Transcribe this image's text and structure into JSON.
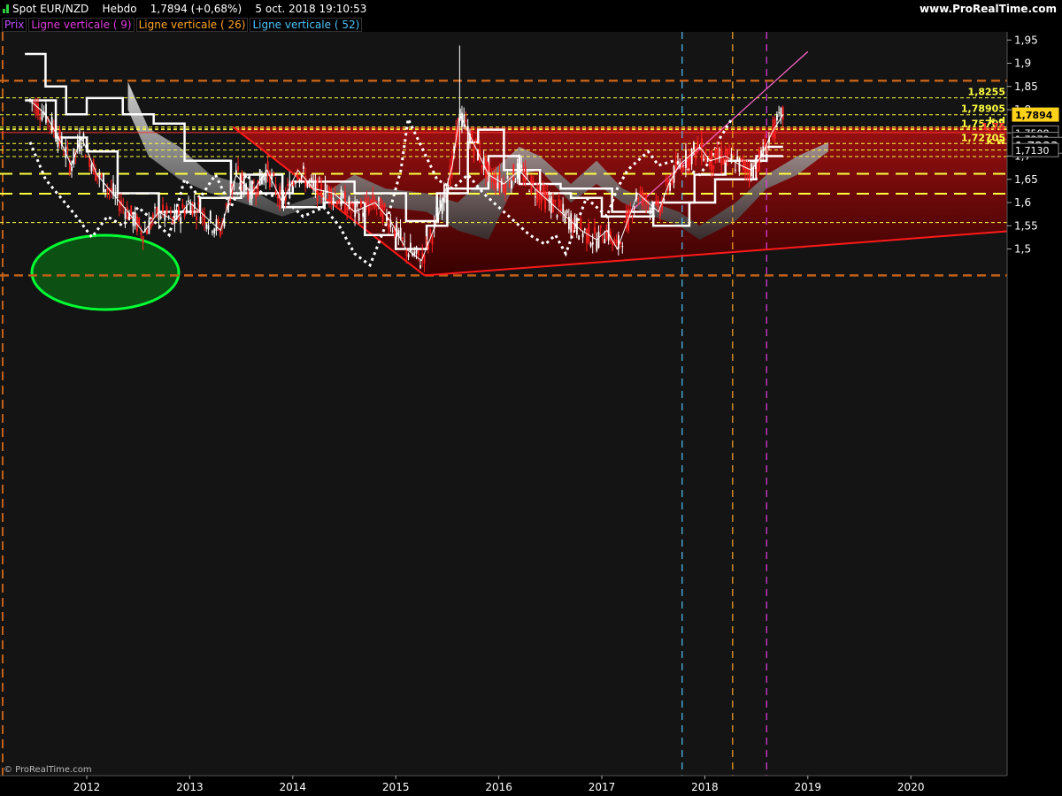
{
  "header": {
    "symbol": "Spot EUR/NZD",
    "period": "Hebdo",
    "price": "1,7894 (+0,68%)",
    "datetime": "5 oct. 2018 19:10:53",
    "site": "www.ProRealTime.com"
  },
  "legend": [
    {
      "label": "Prix",
      "color": "#c050ff"
    },
    {
      "label": "Ligne verticale ( 9)",
      "color": "#e040e0"
    },
    {
      "label": "Ligne verticale ( 26)",
      "color": "#ffa726"
    },
    {
      "label": "Ligne verticale ( 52)",
      "color": "#4fc3f7"
    }
  ],
  "watermark": "© ProRealTime.com",
  "colors": {
    "background": "#000000",
    "plot_background": "#141414",
    "triangle_fill": "#8b0000",
    "candle_up": "#ffffff",
    "candle_down": "#ff2020",
    "cloud_top": "#f0f0f0",
    "cloud_bottom": "#333333",
    "fib_line": "#ffff40",
    "resistance": "#c06018",
    "green_ellipse": "#00ff33",
    "trend_red": "#ff1a1a",
    "trend_pink": "#ff66cc"
  },
  "chart_data": {
    "type": "line",
    "instrument": "EUR/NZD",
    "timeframe": "weekly",
    "x_axis_ticks": [
      "2012",
      "2013",
      "2014",
      "2015",
      "2016",
      "2017",
      "2018",
      "2019",
      "2020"
    ],
    "y_axis_ticks": [
      "1,95",
      "1,9",
      "1,85",
      "1,8",
      "1,75",
      "1,7",
      "1,65",
      "1,6",
      "1,55",
      "1,5"
    ],
    "y_ticks_values": [
      1.95,
      1.9,
      1.85,
      1.8,
      1.75,
      1.7,
      1.65,
      1.6,
      1.55,
      1.5
    ],
    "ylim": [
      1.445,
      1.96
    ],
    "xlim": [
      2011.4,
      2021.2
    ],
    "grid": false,
    "price_path": [
      [
        2011.45,
        1.82
      ],
      [
        2011.6,
        1.79
      ],
      [
        2011.75,
        1.73
      ],
      [
        2011.85,
        1.68
      ],
      [
        2011.95,
        1.74
      ],
      [
        2012.1,
        1.66
      ],
      [
        2012.25,
        1.62
      ],
      [
        2012.4,
        1.58
      ],
      [
        2012.55,
        1.535
      ],
      [
        2012.7,
        1.58
      ],
      [
        2012.85,
        1.56
      ],
      [
        2013.0,
        1.6
      ],
      [
        2013.15,
        1.57
      ],
      [
        2013.3,
        1.54
      ],
      [
        2013.45,
        1.66
      ],
      [
        2013.6,
        1.62
      ],
      [
        2013.75,
        1.67
      ],
      [
        2013.9,
        1.6
      ],
      [
        2014.05,
        1.67
      ],
      [
        2014.2,
        1.63
      ],
      [
        2014.4,
        1.62
      ],
      [
        2014.6,
        1.58
      ],
      [
        2014.8,
        1.6
      ],
      [
        2014.95,
        1.56
      ],
      [
        2015.1,
        1.5
      ],
      [
        2015.25,
        1.475
      ],
      [
        2015.4,
        1.56
      ],
      [
        2015.55,
        1.68
      ],
      [
        2015.62,
        1.79
      ],
      [
        2015.75,
        1.73
      ],
      [
        2015.9,
        1.66
      ],
      [
        2016.05,
        1.64
      ],
      [
        2016.2,
        1.67
      ],
      [
        2016.35,
        1.63
      ],
      [
        2016.5,
        1.6
      ],
      [
        2016.65,
        1.57
      ],
      [
        2016.8,
        1.54
      ],
      [
        2016.95,
        1.52
      ],
      [
        2017.05,
        1.54
      ],
      [
        2017.15,
        1.5
      ],
      [
        2017.25,
        1.56
      ],
      [
        2017.35,
        1.62
      ],
      [
        2017.45,
        1.6
      ],
      [
        2017.55,
        1.58
      ],
      [
        2017.65,
        1.64
      ],
      [
        2017.75,
        1.68
      ],
      [
        2017.85,
        1.7
      ],
      [
        2017.95,
        1.72
      ],
      [
        2018.05,
        1.69
      ],
      [
        2018.2,
        1.7
      ],
      [
        2018.35,
        1.68
      ],
      [
        2018.45,
        1.67
      ],
      [
        2018.55,
        1.7
      ],
      [
        2018.65,
        1.75
      ],
      [
        2018.76,
        1.7894
      ]
    ],
    "annotations": [
      {
        "label": "1,8255",
        "value": 1.8255
      },
      {
        "label": "1,78905",
        "value": 1.78905
      },
      {
        "label": "k d",
        "value": 1.764
      },
      {
        "label": "1,75702",
        "value": 1.75702
      },
      {
        "label": "1,75",
        "value": 1.7508
      },
      {
        "label": "1,72705",
        "value": 1.72705
      },
      {
        "label": "k w",
        "value": 1.72
      }
    ],
    "right_labels": [
      {
        "label": "1,7894",
        "value": 1.7894,
        "style": "price"
      },
      {
        "label": "1,7508",
        "value": 1.7508,
        "style": "box"
      },
      {
        "label": "1,7370",
        "value": 1.737,
        "style": "box"
      },
      {
        "label": "1,7233",
        "value": 1.7233,
        "style": "big"
      },
      {
        "label": "1,7130",
        "value": 1.713,
        "style": "box"
      }
    ],
    "resistance_levels": [
      1.8625,
      1.443
    ],
    "fib_levels_dashed": [
      1.8255,
      1.78905,
      1.7627,
      1.7585,
      1.75702,
      1.72705,
      1.713,
      1.699,
      1.662,
      1.619,
      1.557
    ],
    "vertical_lines": [
      {
        "x": 2017.78,
        "color": "#4fc3f7"
      },
      {
        "x": 2018.27,
        "color": "#ffa726"
      },
      {
        "x": 2018.6,
        "color": "#e040e0"
      }
    ]
  }
}
